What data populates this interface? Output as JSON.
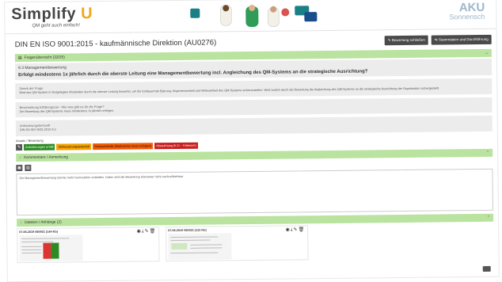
{
  "header": {
    "logo_text": "Simplify",
    "logo_accent": "U",
    "tagline": "QM geht auch einfach!",
    "brand_right_title": "AKU",
    "brand_right_sub": "Sonnensch"
  },
  "document": {
    "title": "DIN EN ISO 9001:2015 - kaufmännische Direktion (AU0276)",
    "buttons": [
      "Bewertung schließen",
      "Stammdaten und Durchführung"
    ]
  },
  "question_overview": {
    "label": "Fragenübersicht (33/35)"
  },
  "question": {
    "category": "9.3 Managementbewertung",
    "title": "Erfolgt mindestens 1x jährlich durch die oberste Leitung eine Managementbewertung incl. Angleichung des QM-Systems an die strategische Ausrichtung?",
    "purpose_label": "Zweck der Frage",
    "purpose_text": "Wird das QM-System in festgelegten Abständen durch die oberste Leitung bewertet, um die fortdauernde Eignung, Angemessenheit und Wirksamkeit des QM-Systems sicherzustellen. Wird zudem durch die Bewertung die Angleichung des QM-Systems an die strategische Ausrichtung der Organisation sichergestellt.",
    "desc_label": "Beschreibung Erfüllungsziel - Wie was gibt es für die Frage?",
    "desc_text": "Die Bewertung des QM-Systems muss mindestens 1x jährlich erfolgen.",
    "req_label": "Anforderungsherkunft",
    "req_text": "DIN EN ISO 9001:2015 9.3"
  },
  "rating": {
    "label": "Ansatz / Bewertung",
    "options": [
      {
        "label": "Anforderungen erfüllt",
        "color": "#2e8b24"
      },
      {
        "label": "Verbesserungspotential",
        "color": "#f5a300"
      },
      {
        "label": "Schwachstelle (Maßnahme muss erfolgen)",
        "color": "#f25c05"
      },
      {
        "label": "Abweichung (K.O. - Kriterium)",
        "color": "#c81e1e"
      }
    ]
  },
  "comments": {
    "label": "Kommentare / Anmerkung",
    "text": "Die Managementbewertung könnte mehr Kennzahlen enthalten. Daten sind die Bewertung relevanter nicht nachvollziehbar."
  },
  "files": {
    "label": "Dateien / Anhänge (2)",
    "items": [
      {
        "caption": "07.06.2019 080921 (144 Kb)"
      },
      {
        "caption": "07.06.2019 080021 (112 Kb)"
      }
    ]
  },
  "colors": {
    "accent_green": "#b9e39f",
    "logo_orange": "#f3a51b",
    "dark_button": "#4a4a4a"
  }
}
